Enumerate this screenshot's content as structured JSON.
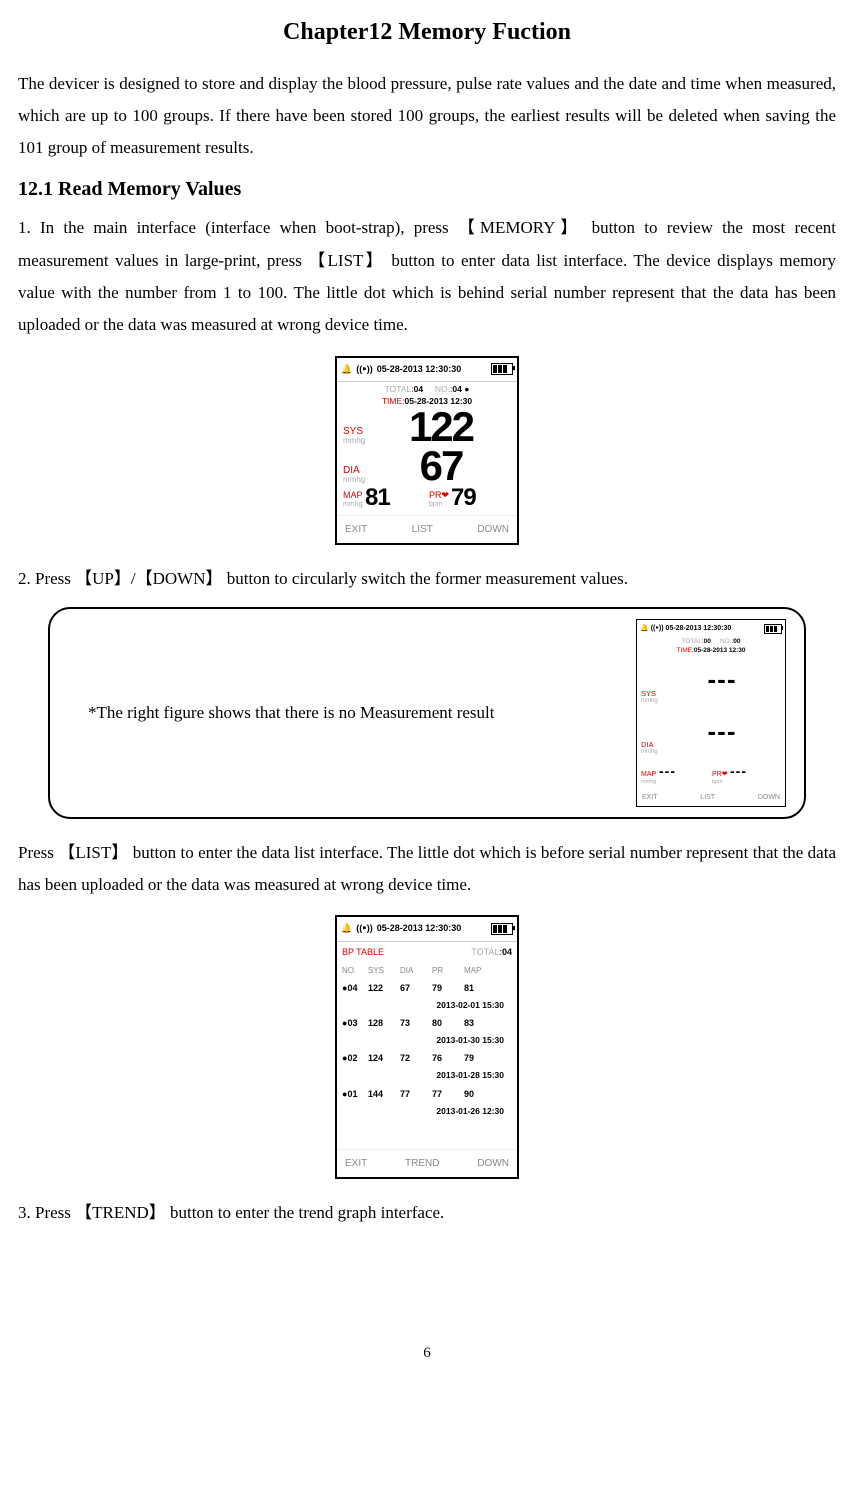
{
  "chapter_title": "Chapter12 Memory Fuction",
  "intro": "The devicer is designed to store and display the blood pressure, pulse rate values and the date and time when measured, which are up to 100 groups. If there have been stored 100 groups, the earliest results will be deleted when saving the 101 group of measurement results.",
  "section_12_1": "12.1 Read Memory Values",
  "para1": "1. In the main interface (interface when boot-strap), press  【MEMORY】  button to review the most recent measurement values in large-print, press 【LIST】 button to enter data list interface. The device displays memory value with the number from 1 to 100. The little dot which is behind serial number represent that the data has been uploaded or the data was measured at wrong device time.",
  "para2": "2. Press  【UP】/【DOWN】  button to circularly switch the former measurement values.",
  "callout_text": "*The right figure shows that there is no Measurement result",
  "para_list": "Press 【LIST】 button to enter the data list interface. The little dot which is before serial number represent that the data has been uploaded or the data was measured at wrong device time.",
  "para3": "3.  Press  【TREND】  button to enter the trend graph interface.",
  "page_number": "6",
  "labels": {
    "bell": "🔔",
    "signal": "((⁍))",
    "total": "TOTAL",
    "no": "NO.",
    "time": "TIME",
    "sys": "SYS",
    "dia": "DIA",
    "map": "MAP",
    "pr": "PR",
    "heart": "❤",
    "mmhg": "mmhg",
    "bpm": "bpm",
    "exit": "EXIT",
    "list": "LIST",
    "down": "DOWN",
    "trend": "TREND",
    "bp_table": "BP TABLE",
    "col_no": "NO.",
    "col_sys": "SYS",
    "col_dia": "DIA",
    "col_pr": "PR",
    "col_map": "MAP"
  },
  "fig1": {
    "status_datetime": "05-28-2013  12:30:30",
    "total": "04",
    "no": "04",
    "dot": "●",
    "time": "05-28-2013  12:30",
    "sys": "122",
    "dia": "67",
    "map": "81",
    "pr": "79"
  },
  "fig2": {
    "status_datetime": "05-28-2013  12:30:30",
    "total": "00",
    "no": "00",
    "time": "05-28-2013  12:30",
    "dash": "---"
  },
  "fig3": {
    "status_datetime": "05-28-2013  12:30:30",
    "total": "04",
    "rows": [
      {
        "dot": "●",
        "no": "04",
        "sys": "122",
        "dia": "67",
        "pr": "79",
        "map": "81",
        "dt": "2013-02-01 15:30"
      },
      {
        "dot": "●",
        "no": "03",
        "sys": "128",
        "dia": "73",
        "pr": "80",
        "map": "83",
        "dt": "2013-01-30 15:30"
      },
      {
        "dot": "●",
        "no": "02",
        "sys": "124",
        "dia": "72",
        "pr": "76",
        "map": "79",
        "dt": "2013-01-28 15:30"
      },
      {
        "dot": "●",
        "no": "01",
        "sys": "144",
        "dia": "77",
        "pr": "77",
        "map": "90",
        "dt": "2013-01-26 12:30"
      }
    ]
  }
}
